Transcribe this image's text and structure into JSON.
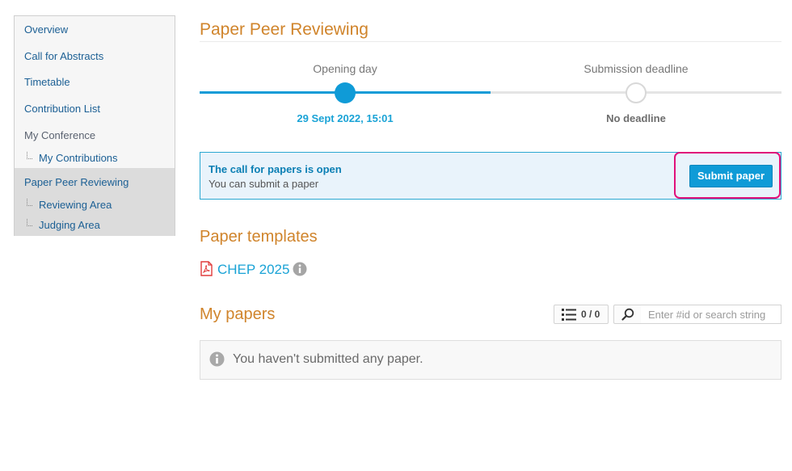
{
  "sidebar": {
    "items": [
      {
        "label": "Overview"
      },
      {
        "label": "Call for Abstracts"
      },
      {
        "label": "Timetable"
      },
      {
        "label": "Contribution List"
      },
      {
        "label": "My Conference"
      },
      {
        "label": "My Contributions"
      },
      {
        "label": "Paper Peer Reviewing"
      },
      {
        "label": "Reviewing Area"
      },
      {
        "label": "Judging Area"
      }
    ]
  },
  "main": {
    "title": "Paper Peer Reviewing",
    "timeline": {
      "opening_label": "Opening day",
      "opening_value": "29 Sept 2022, 15:01",
      "deadline_label": "Submission deadline",
      "deadline_value": "No deadline"
    },
    "call": {
      "title": "The call for papers is open",
      "subtitle": "You can submit a paper",
      "button_label": "Submit paper"
    },
    "templates": {
      "heading": "Paper templates",
      "items": [
        {
          "name": "CHEP 2025",
          "icon": "pdf-icon"
        }
      ]
    },
    "papers": {
      "heading": "My papers",
      "count": "0 / 0",
      "search_placeholder": "Enter #id or search string",
      "empty_message": "You haven't submitted any paper."
    }
  },
  "colors": {
    "accent": "#0f9bd7",
    "heading": "#d0842b",
    "highlight": "#e0107a",
    "link": "#1b5f94"
  }
}
